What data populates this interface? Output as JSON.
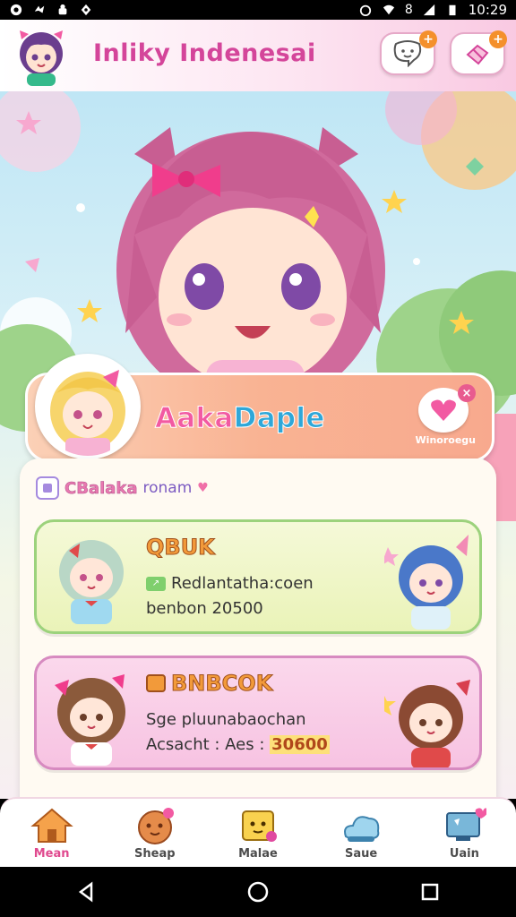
{
  "status_bar": {
    "time": "10:29",
    "battery": "8"
  },
  "header": {
    "title": "Inliky Indenesai",
    "chat_badge": "+",
    "gift_badge": "+"
  },
  "profile": {
    "name_part1": "Aaka",
    "name_part2": "Daple",
    "like_caption": "Winoroegu",
    "close": "×"
  },
  "section": {
    "title": "CBalaka",
    "subtitle": "ronam",
    "heart": "♥"
  },
  "quests": [
    {
      "title": "QBUK",
      "line1": "Redlantatha:coen",
      "line2": "benbon 20500"
    },
    {
      "title": "BNBCOK",
      "line1": "Sge pluunabaochan",
      "line2_label": "Acsacht : Aes :",
      "line2_value": "30600"
    }
  ],
  "nav": [
    {
      "label": "Mean",
      "icon": "home-icon"
    },
    {
      "label": "Sheap",
      "icon": "cookie-icon"
    },
    {
      "label": "Malae",
      "icon": "book-icon"
    },
    {
      "label": "Saue",
      "icon": "cloud-icon"
    },
    {
      "label": "Uain",
      "icon": "monitor-icon"
    }
  ],
  "colors": {
    "brand": "#d4459a",
    "profile_card": "#f9b393",
    "quest1_border": "#9cd27c",
    "quest2_border": "#d78ac0",
    "active_nav": "#e0498e"
  }
}
